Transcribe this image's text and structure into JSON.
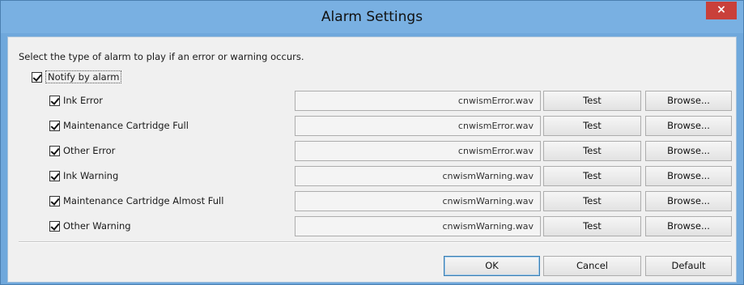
{
  "window": {
    "title": "Alarm Settings",
    "close_label": "×",
    "colors": {
      "titlebar": "#79b0e2",
      "close": "#c9403a",
      "client": "#f0f0f0"
    }
  },
  "instruction": "Select the type of alarm to play if an error or warning occurs.",
  "notify": {
    "label": "Notify by alarm",
    "checked": true
  },
  "alarms": [
    {
      "label": "Ink Error",
      "checked": true,
      "file": "cnwismError.wav"
    },
    {
      "label": "Maintenance Cartridge Full",
      "checked": true,
      "file": "cnwismError.wav"
    },
    {
      "label": "Other Error",
      "checked": true,
      "file": "cnwismError.wav"
    },
    {
      "label": "Ink Warning",
      "checked": true,
      "file": "cnwismWarning.wav"
    },
    {
      "label": "Maintenance Cartridge Almost Full",
      "checked": true,
      "file": "cnwismWarning.wav"
    },
    {
      "label": "Other Warning",
      "checked": true,
      "file": "cnwismWarning.wav"
    }
  ],
  "row_buttons": {
    "test": "Test",
    "browse": "Browse..."
  },
  "footer": {
    "ok": "OK",
    "cancel": "Cancel",
    "default": "Default"
  }
}
